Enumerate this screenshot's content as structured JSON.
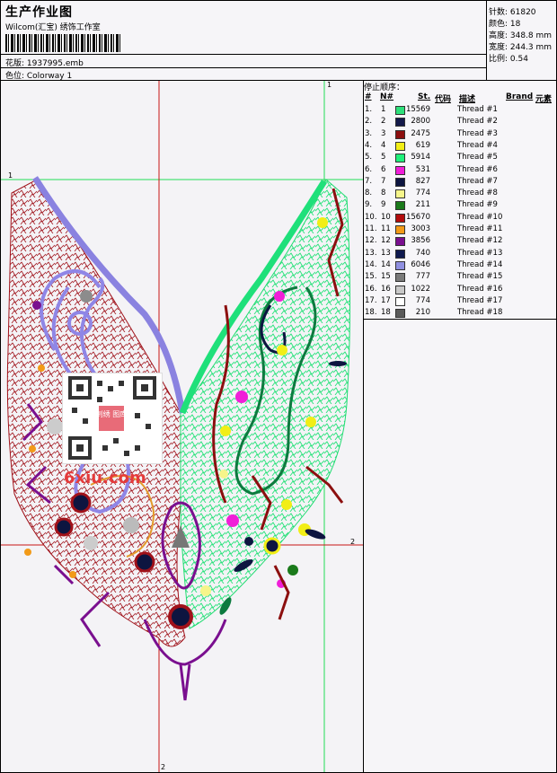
{
  "header": {
    "title": "生产作业图",
    "company": "Wilcom(汇宝) 绣饰工作室",
    "pattern_label": "花版: 1937995.emb",
    "color_label": "色位: Colorway 1"
  },
  "stats": {
    "stitches": "针数: 61820",
    "colors": "颜色: 18",
    "height": "高度: 348.8 mm",
    "width": "宽度: 244.3 mm",
    "scale": "比例: 0.54"
  },
  "design": {
    "guide_labels": [
      "1",
      "1",
      "2",
      "2"
    ]
  },
  "stop_sequence": {
    "title": "停止顺序：",
    "headers": [
      "#",
      "N#",
      "St.",
      "代码",
      "描述",
      "Brand",
      "元素"
    ],
    "rows": [
      {
        "idx": "1.",
        "n": "1",
        "st": "15569",
        "desc": "Thread #1",
        "color": "#2ee07a"
      },
      {
        "idx": "2.",
        "n": "2",
        "st": "2800",
        "desc": "Thread #2",
        "color": "#141a4a"
      },
      {
        "idx": "3.",
        "n": "3",
        "st": "2475",
        "desc": "Thread #3",
        "color": "#8c0f0f"
      },
      {
        "idx": "4.",
        "n": "4",
        "st": "619",
        "desc": "Thread #4",
        "color": "#f2ee16"
      },
      {
        "idx": "5.",
        "n": "5",
        "st": "5914",
        "desc": "Thread #5",
        "color": "#1ff07a"
      },
      {
        "idx": "6.",
        "n": "6",
        "st": "531",
        "desc": "Thread #6",
        "color": "#f01ed8"
      },
      {
        "idx": "7.",
        "n": "7",
        "st": "827",
        "desc": "Thread #7",
        "color": "#0d1540"
      },
      {
        "idx": "8.",
        "n": "8",
        "st": "774",
        "desc": "Thread #8",
        "color": "#f6f58a"
      },
      {
        "idx": "9.",
        "n": "9",
        "st": "211",
        "desc": "Thread #9",
        "color": "#1b7a1b"
      },
      {
        "idx": "10.",
        "n": "10",
        "st": "15670",
        "desc": "Thread #10",
        "color": "#b30d0d"
      },
      {
        "idx": "11.",
        "n": "11",
        "st": "3003",
        "desc": "Thread #11",
        "color": "#f29a18"
      },
      {
        "idx": "12.",
        "n": "12",
        "st": "3856",
        "desc": "Thread #12",
        "color": "#7a0f8f"
      },
      {
        "idx": "13.",
        "n": "13",
        "st": "740",
        "desc": "Thread #13",
        "color": "#0f1a4f"
      },
      {
        "idx": "14.",
        "n": "14",
        "st": "6046",
        "desc": "Thread #14",
        "color": "#8f8fe0"
      },
      {
        "idx": "15.",
        "n": "15",
        "st": "777",
        "desc": "Thread #15",
        "color": "#7a7a7a"
      },
      {
        "idx": "16.",
        "n": "16",
        "st": "1022",
        "desc": "Thread #16",
        "color": "#c8c8c8"
      },
      {
        "idx": "17.",
        "n": "17",
        "st": "774",
        "desc": "Thread #17",
        "color": "#ffffff"
      },
      {
        "idx": "18.",
        "n": "18",
        "st": "210",
        "desc": "Thread #18",
        "color": "#5a5a5a"
      }
    ]
  },
  "watermark": "6xiu.com",
  "qr_stamp": "刺绣 图库"
}
